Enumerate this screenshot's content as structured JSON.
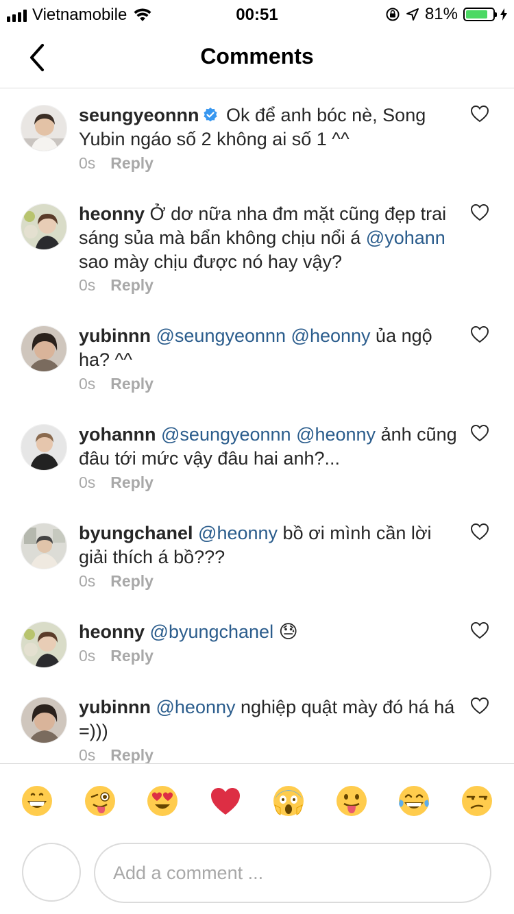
{
  "status_bar": {
    "carrier": "Vietnamobile",
    "time": "00:51",
    "battery_percent": "81%",
    "battery_level": 0.81,
    "battery_color": "#4cd964"
  },
  "nav": {
    "title": "Comments",
    "back_icon": "chevron-left-icon"
  },
  "comments": [
    {
      "username": "seungyeonnn",
      "verified": true,
      "text": " Ok để anh bóc nè, Song Yubin ngáo số 2 không ai số 1 ^^",
      "time": "0s",
      "reply_label": "Reply"
    },
    {
      "username": "heonny",
      "text_before": " Ở dơ nữa nha đm mặt cũng đẹp trai sáng sủa mà bẩn không chịu nổi á ",
      "mention": "@yohann",
      "text_after": " sao mày chịu được nó hay vậy?",
      "time": "0s",
      "reply_label": "Reply"
    },
    {
      "username": "yubinnn",
      "mentions": "@seungyeonnn @heonny",
      "text": " ủa ngộ ha? ^^",
      "time": "0s",
      "reply_label": "Reply"
    },
    {
      "username": "yohannn",
      "mentions": "@seungyeonnn @heonny",
      "text": " ảnh cũng đâu tới mức vậy đâu hai anh?...",
      "time": "0s",
      "reply_label": "Reply"
    },
    {
      "username": "byungchanel",
      "mentions": "@heonny",
      "text": " bồ ơi mình cần lời giải thích á bồ???",
      "time": "0s",
      "reply_label": "Reply"
    },
    {
      "username": "heonny",
      "mentions": "@byungchanel",
      "text": " 😓",
      "time": "0s",
      "reply_label": "Reply"
    },
    {
      "username": "yubinnn",
      "mentions": "@heonny",
      "text": " nghiệp quật mày đó há há =)))",
      "time": "0s",
      "reply_label": "Reply"
    }
  ],
  "emoji_bar": [
    "grinning-face",
    "winking-tongue-face",
    "heart-eyes-face",
    "red-heart",
    "screaming-face",
    "tongue-face",
    "tears-of-joy-face",
    "unamused-face"
  ],
  "composer": {
    "placeholder": "Add a comment ..."
  },
  "colors": {
    "mention": "#2a5c8c",
    "verified": "#3897f0",
    "divider": "#dbdbdb"
  }
}
